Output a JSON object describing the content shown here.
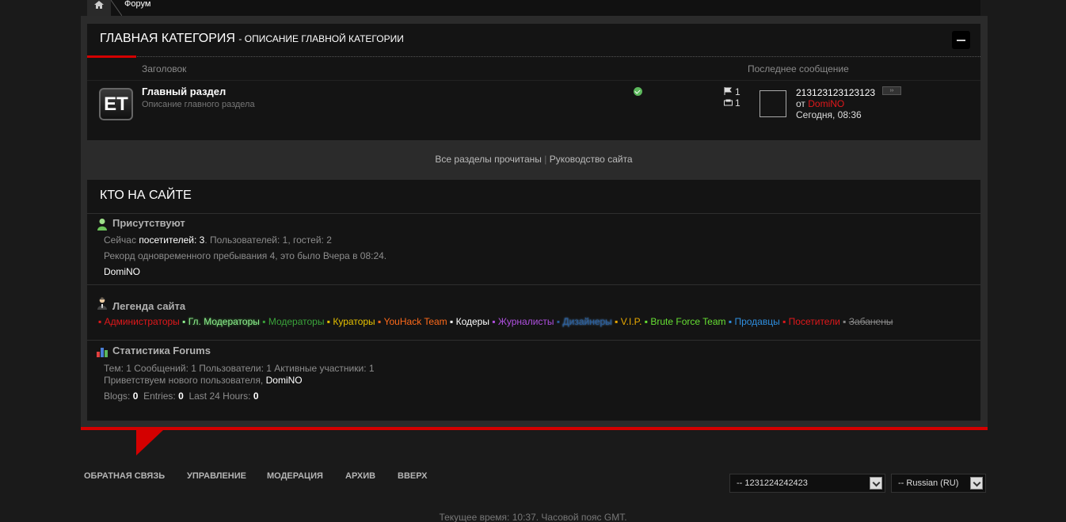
{
  "breadcrumb": {
    "current": "Форум"
  },
  "category": {
    "title": "ГЛАВНАЯ КАТЕГОРИЯ",
    "description": "- ОПИСАНИЕ ГЛАВНОЙ КАТЕГОРИИ",
    "col_title": "Заголовок",
    "col_last": "Последнее сообщение",
    "forum": {
      "icon_text": "ET",
      "title": "Главный раздел",
      "description": "Описание главного раздела",
      "threads": "1",
      "posts": "1",
      "last_title": "213123123123123",
      "last_goto": "›› ",
      "last_by_prefix": "от",
      "last_by_user": "DomiNO",
      "last_time": "Сегодня, 08:36"
    }
  },
  "links": {
    "mark_read": "Все разделы прочитаны",
    "separator": "|",
    "guide": "Руководство сайта"
  },
  "who": {
    "title": "КТО НА САЙТЕ",
    "present": {
      "title": "Присутствуют",
      "line1_pre": "Сейчас",
      "line1_label": "посетителей:",
      "line1_count": "3",
      "line1_rest": ". Пользователей: 1, гостей: 2",
      "record": "Рекорд одновременного пребывания 4, это было Вчера в 08:24.",
      "user": "DomiNO"
    },
    "legend": {
      "title": "Легенда сайта",
      "items": [
        {
          "label": "Администраторы",
          "color": "#e0181b"
        },
        {
          "label": "Гл. Модераторы",
          "color": "#8ff08f"
        },
        {
          "label": "Модераторы",
          "color": "#3aa33a"
        },
        {
          "label": "Кураторы",
          "color": "#e6c100"
        },
        {
          "label": "YouHack Team",
          "color": "#ff6a1a"
        },
        {
          "label": "Кодеры",
          "color": "#ffffff"
        },
        {
          "label": "Журналисты",
          "color": "#b050e0"
        },
        {
          "label": "Дизайнеры",
          "color": "#2a5d9a"
        },
        {
          "label": "V.I.P.",
          "color": "#e8a800"
        },
        {
          "label": "Brute Force Team",
          "color": "#66e033"
        },
        {
          "label": "Продавцы",
          "color": "#2f8fe0"
        },
        {
          "label": "Посетители",
          "color": "#e0181b"
        },
        {
          "label": "Забанены",
          "color": "#888888"
        }
      ]
    },
    "stats": {
      "title": "Статистика Forums",
      "line1": "Тем: 1  Сообщений: 1  Пользователи: 1  Активные участники: 1",
      "welcome": "Приветствуем нового пользователя,",
      "new_user": "DomiNO",
      "blogs_label": "Blogs:",
      "blogs": "0",
      "entries_label": "Entries:",
      "entries": "0",
      "last24_label": "Last 24 Hours:",
      "last24": "0"
    }
  },
  "footer": {
    "nav": [
      "ОБРАТНАЯ СВЯЗЬ",
      "УПРАВЛЕНИЕ",
      "МОДЕРАЦИЯ",
      "АРХИВ",
      "ВВЕРХ"
    ],
    "style_select": "-- 1231224242423",
    "lang_select": "-- Russian (RU)",
    "time": "Текущее время: 10:37. Часовой пояс GMT."
  }
}
